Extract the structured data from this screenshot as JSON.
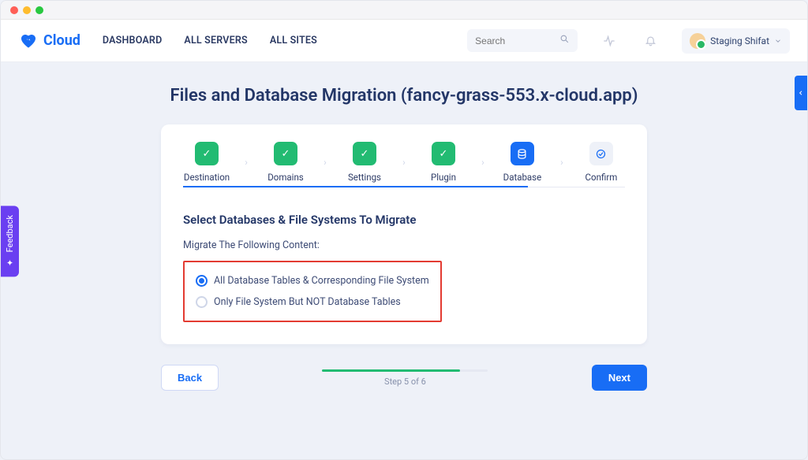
{
  "brand": {
    "name": "Cloud"
  },
  "nav": {
    "dashboard": "DASHBOARD",
    "servers": "ALL SERVERS",
    "sites": "ALL SITES"
  },
  "search": {
    "placeholder": "Search"
  },
  "user": {
    "name": "Staging Shifat"
  },
  "page": {
    "title": "Files and Database Migration (fancy-grass-553.x-cloud.app)"
  },
  "steps": [
    {
      "label": "Destination",
      "state": "done"
    },
    {
      "label": "Domains",
      "state": "done"
    },
    {
      "label": "Settings",
      "state": "done"
    },
    {
      "label": "Plugin",
      "state": "done"
    },
    {
      "label": "Database",
      "state": "active"
    },
    {
      "label": "Confirm",
      "state": "pending"
    }
  ],
  "section": {
    "heading": "Select Databases & File Systems To Migrate",
    "subheading": "Migrate The Following Content:",
    "options": [
      {
        "label": "All Database Tables & Corresponding File System",
        "selected": true
      },
      {
        "label": "Only File System But NOT Database Tables",
        "selected": false
      }
    ]
  },
  "footer": {
    "back": "Back",
    "next": "Next",
    "step_text": "Step 5 of 6"
  },
  "feedback_label": "Feedback"
}
